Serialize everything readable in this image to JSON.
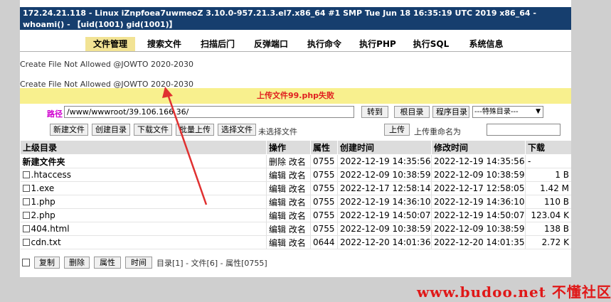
{
  "header": {
    "sysinfo": "172.24.21.118 - Linux iZnpfoea7uwmeoZ 3.10.0-957.21.3.el7.x86_64 #1 SMP Tue Jun 18 16:35:19 UTC 2019 x86_64 - whoami() - 【uid(1001) gid(1001)】"
  },
  "nav": {
    "tabs": [
      {
        "label": "文件管理",
        "active": true
      },
      {
        "label": "搜索文件"
      },
      {
        "label": "扫描后门"
      },
      {
        "label": "反弹端口"
      },
      {
        "label": "执行命令"
      },
      {
        "label": "执行PHP"
      },
      {
        "label": "执行SQL"
      },
      {
        "label": "系统信息"
      }
    ]
  },
  "messages": [
    "Create File Not Allowed @JOWTO 2020-2030",
    "Create File Not Allowed @JOWTO 2020-2030"
  ],
  "alert": "上传文件99.php失败",
  "path": {
    "label": "路径",
    "value": "/www/wwwroot/39.106.166.36/",
    "goto": "转到",
    "root_dir": "根目录",
    "program_dir": "程序目录",
    "special_dir": "---特殊目录---"
  },
  "toolbar": {
    "new_file": "新建文件",
    "new_dir": "创建目录",
    "download_file": "下载文件",
    "batch_upload": "批量上传",
    "choose_file": "选择文件",
    "no_file_chosen": "未选择文件",
    "upload": "上传",
    "rename_label": "上传重命名为"
  },
  "table": {
    "headers": [
      "上级目录",
      "操作",
      "属性",
      "创建时间",
      "修改时间",
      "下载"
    ],
    "new_folder": "新建文件夹",
    "new_folder_ops": "删除 改名",
    "new_folder_perm": "0755",
    "new_folder_ctime": "2022-12-19 14:35:56",
    "new_folder_mtime": "2022-12-19 14:35:56",
    "new_folder_dl": "-",
    "rows": [
      {
        "name": ".htaccess",
        "ops": "编辑 改名",
        "perm": "0755",
        "ctime": "2022-12-09 10:38:59",
        "mtime": "2022-12-09 10:38:59",
        "size": "1 B"
      },
      {
        "name": "1.exe",
        "ops": "编辑 改名",
        "perm": "0755",
        "ctime": "2022-12-17 12:58:14",
        "mtime": "2022-12-17 12:58:05",
        "size": "1.42 M"
      },
      {
        "name": "1.php",
        "ops": "编辑 改名",
        "perm": "0755",
        "ctime": "2022-12-19 14:36:10",
        "mtime": "2022-12-19 14:36:10",
        "size": "110 B"
      },
      {
        "name": "2.php",
        "ops": "编辑 改名",
        "perm": "0755",
        "ctime": "2022-12-19 14:50:07",
        "mtime": "2022-12-19 14:50:07",
        "size": "123.04 K"
      },
      {
        "name": "404.html",
        "ops": "编辑 改名",
        "perm": "0755",
        "ctime": "2022-12-09 10:38:59",
        "mtime": "2022-12-09 10:38:59",
        "size": "138 B"
      },
      {
        "name": "cdn.txt",
        "ops": "编辑 改名",
        "perm": "0644",
        "ctime": "2022-12-20 14:01:36",
        "mtime": "2022-12-20 14:01:35",
        "size": "2.72 K"
      }
    ]
  },
  "footer": {
    "copy": "复制",
    "delete": "删除",
    "attr": "属性",
    "time": "时间",
    "status": "目录[1] - 文件[6] - 属性[0755]"
  },
  "watermark": "www.budoo.net 不懂社区",
  "colors": {
    "header_bg": "#163e6e",
    "alert_bg": "#f8f08e",
    "alert_text": "#e02020",
    "arrow": "#e03030"
  }
}
